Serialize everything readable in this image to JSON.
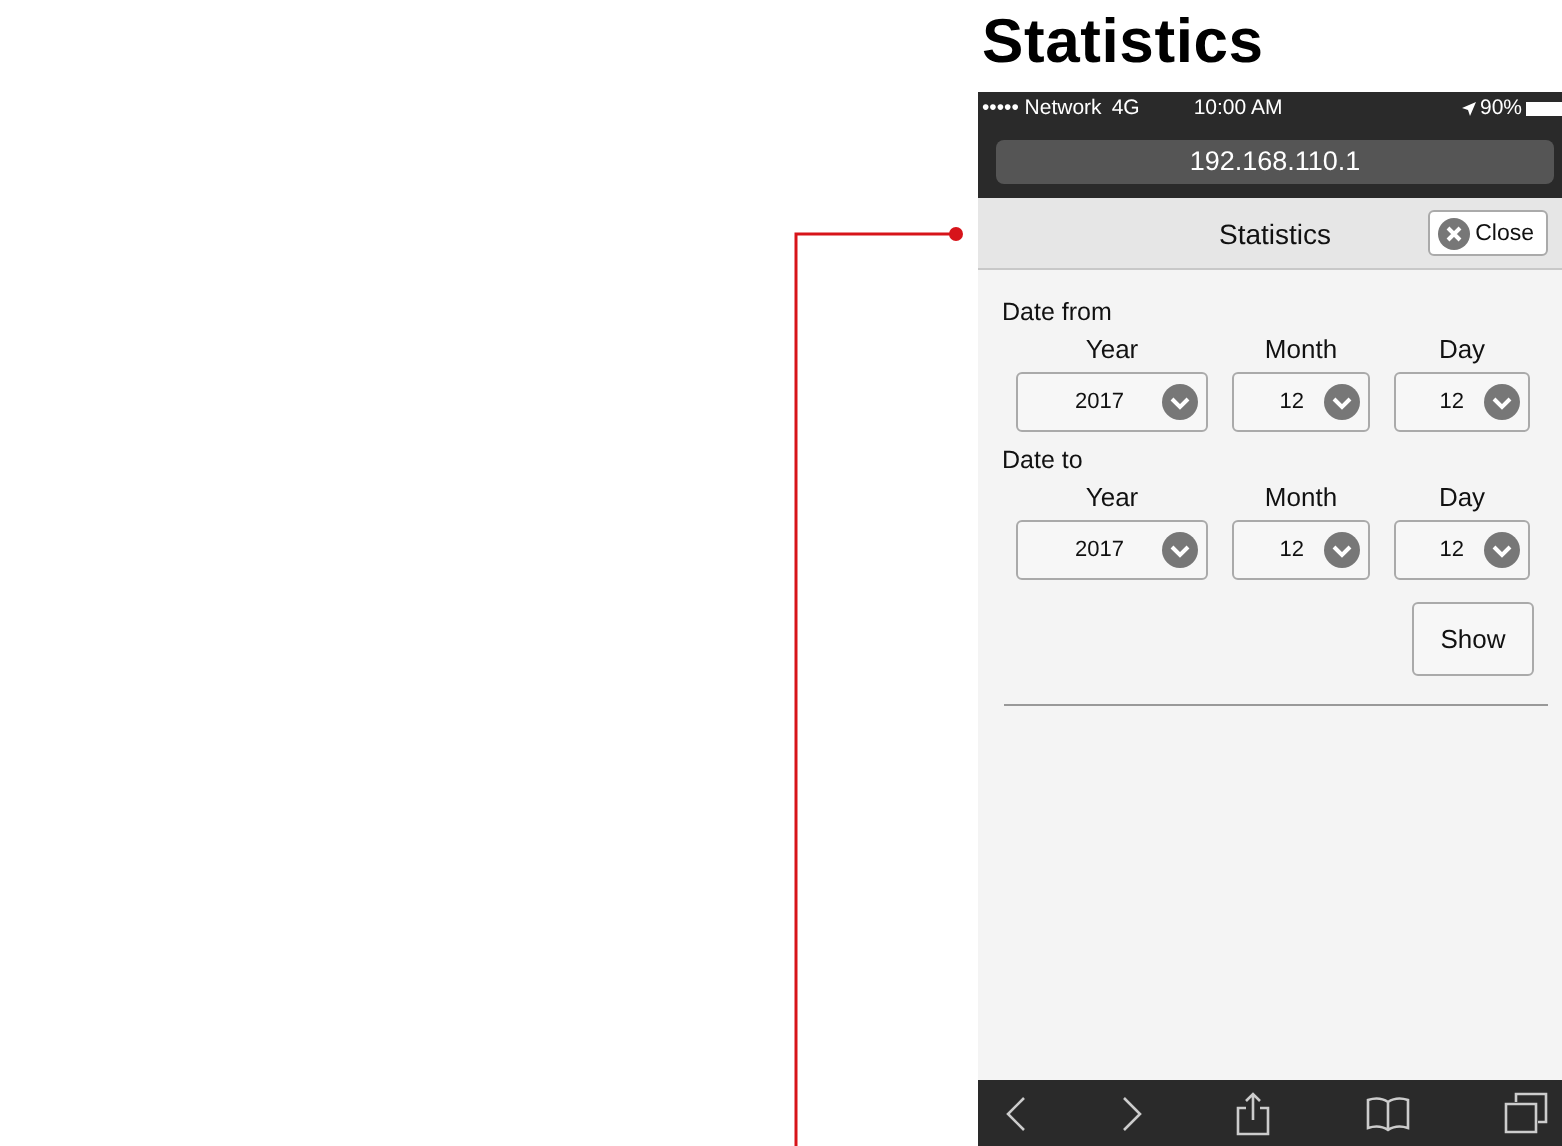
{
  "heading": "Statistics",
  "status_bar": {
    "carrier": "••••• Network",
    "network": "4G",
    "time": "10:00 AM",
    "battery": "90%"
  },
  "address": "192.168.110.1",
  "nav": {
    "title": "Statistics",
    "close": "Close"
  },
  "sections": [
    {
      "label": "Date from",
      "fields": [
        {
          "label": "Year",
          "value": "2017"
        },
        {
          "label": "Month",
          "value": "12"
        },
        {
          "label": "Day",
          "value": "12"
        }
      ]
    },
    {
      "label": "Date to",
      "fields": [
        {
          "label": "Year",
          "value": "2017"
        },
        {
          "label": "Month",
          "value": "12"
        },
        {
          "label": "Day",
          "value": "12"
        }
      ]
    }
  ],
  "show_button": "Show"
}
